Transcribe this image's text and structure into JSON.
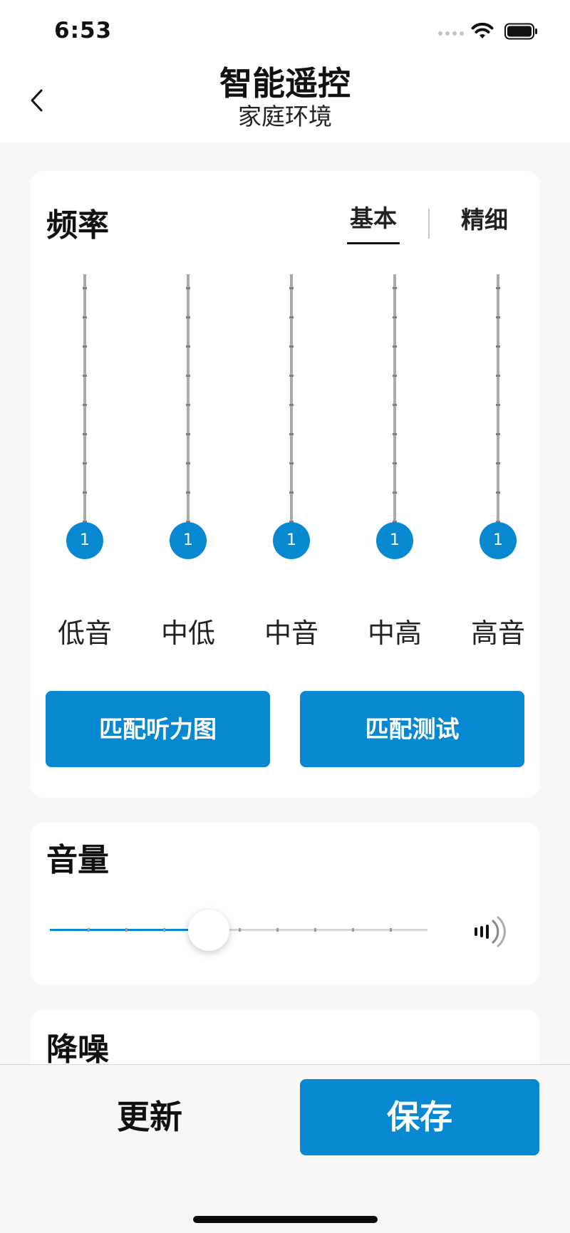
{
  "status_bar": {
    "time": "6:53",
    "icons": [
      "signal-dots-icon",
      "wifi-icon",
      "battery-icon"
    ]
  },
  "header": {
    "title": "智能遥控",
    "subtitle": "家庭环境",
    "back_icon": "chevron-left-icon"
  },
  "frequency": {
    "title": "频率",
    "tabs": [
      {
        "label": "基本",
        "active": true
      },
      {
        "label": "精细",
        "active": false
      }
    ],
    "bands": [
      {
        "label": "低音",
        "value": "1"
      },
      {
        "label": "中低",
        "value": "1"
      },
      {
        "label": "中音",
        "value": "1"
      },
      {
        "label": "中高",
        "value": "1"
      },
      {
        "label": "高音",
        "value": "1"
      }
    ],
    "buttons": {
      "match_audiogram": "匹配听力图",
      "match_test": "匹配测试"
    }
  },
  "volume": {
    "title": "音量",
    "level_fraction": 0.42,
    "icon": "speaker-volume-icon"
  },
  "noise_reduction": {
    "title": "降噪"
  },
  "bottom": {
    "update_label": "更新",
    "save_label": "保存"
  },
  "colors": {
    "accent": "#0788d0",
    "background": "#f7f7f7",
    "card": "#ffffff"
  }
}
